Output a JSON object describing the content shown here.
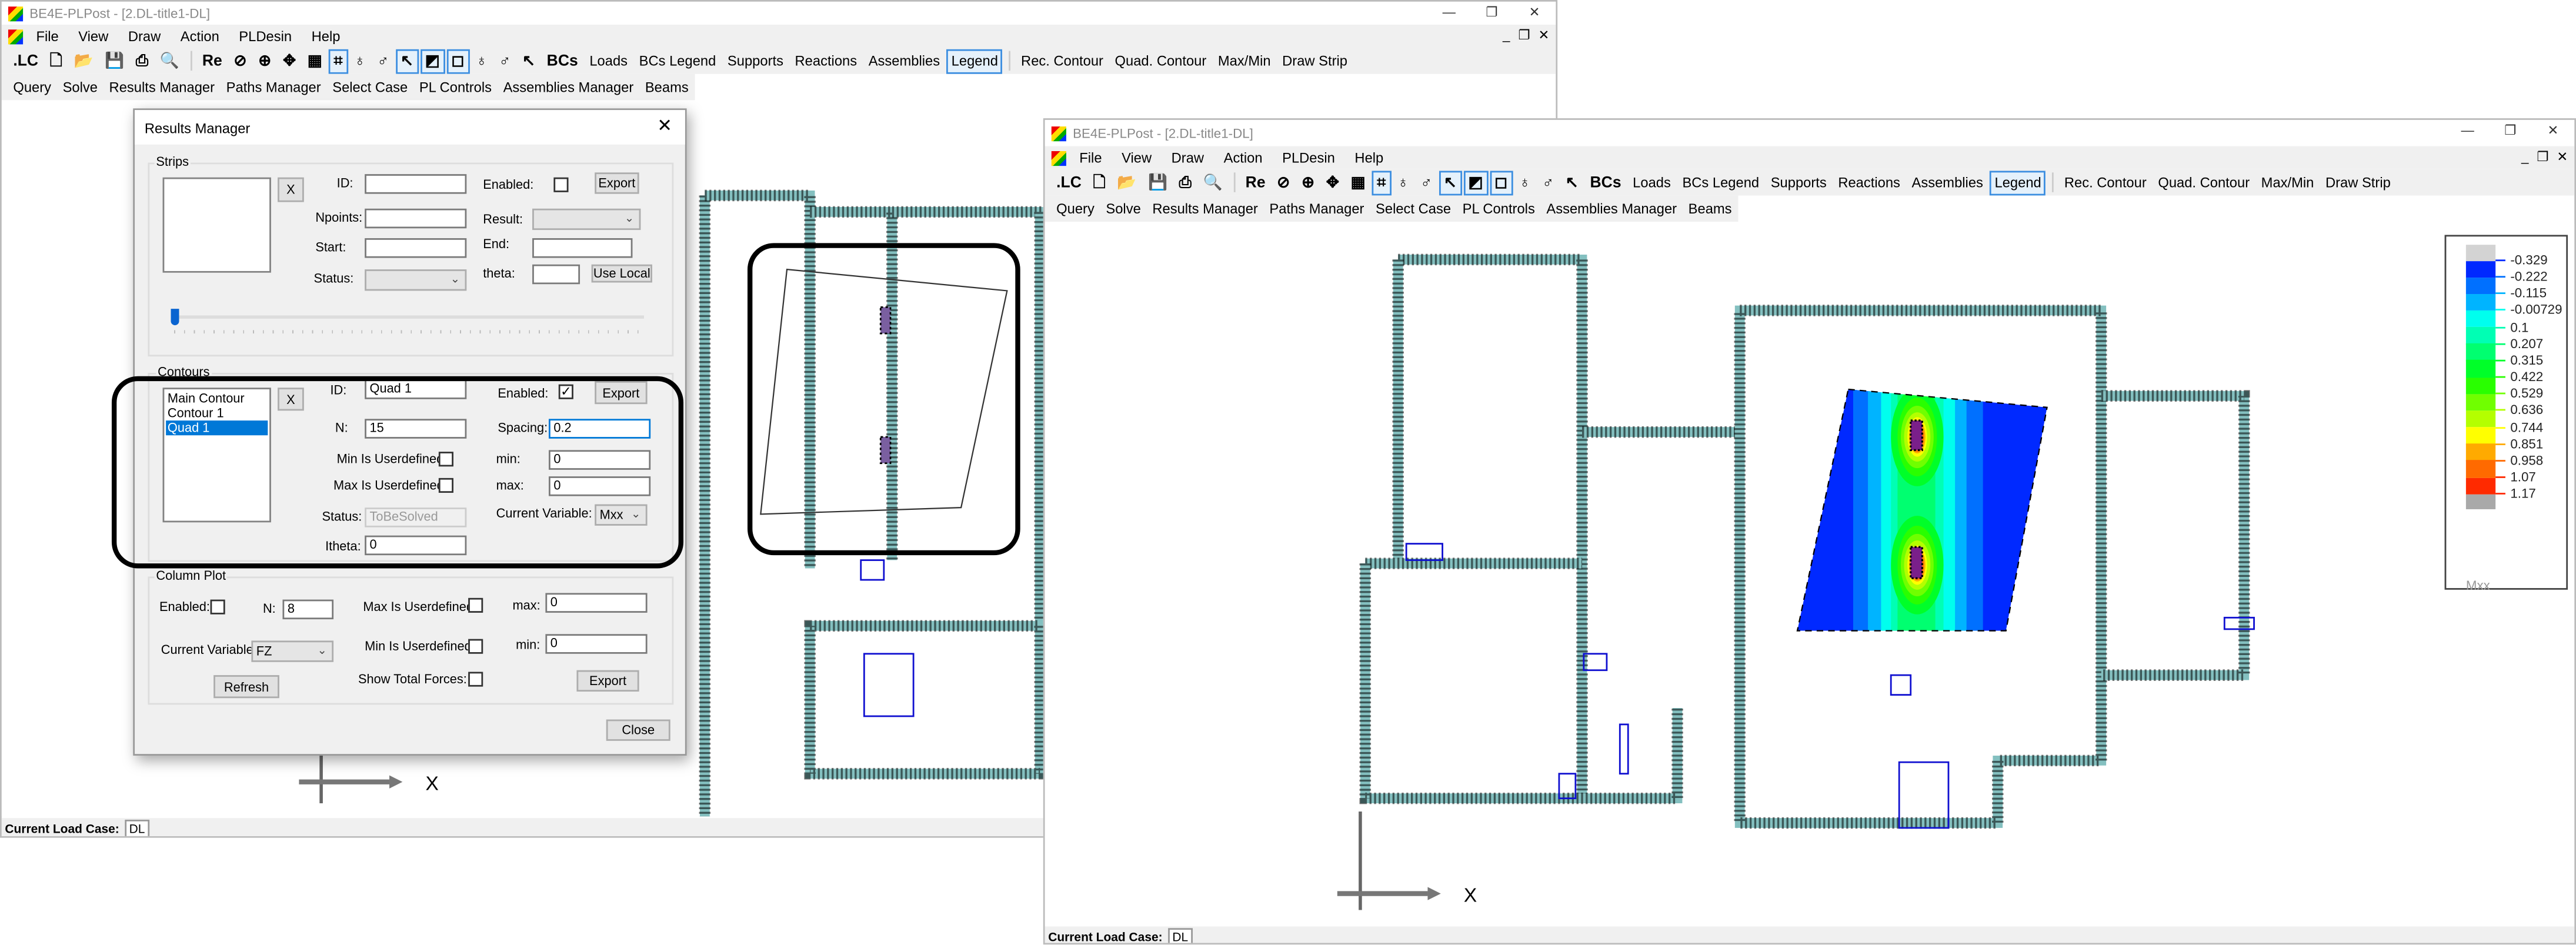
{
  "left_window": {
    "title": "BE4E-PLPost - [2.DL-title1-DL]",
    "menu": [
      "File",
      "View",
      "Draw",
      "Action",
      "PLDesin",
      "Help"
    ],
    "toolbar1": [
      {
        "label": ".LC",
        "icon": "load-case-icon",
        "glyph": ".LC"
      },
      {
        "label": "",
        "icon": "new-file-icon",
        "glyph": "🗋"
      },
      {
        "label": "",
        "icon": "open-folder-icon",
        "glyph": "📂"
      },
      {
        "label": "",
        "icon": "save-icon",
        "glyph": "💾"
      },
      {
        "label": "",
        "icon": "print-icon",
        "glyph": "⎙"
      },
      {
        "label": "",
        "icon": "print-preview-icon",
        "glyph": "🔍"
      },
      {
        "sep": true
      },
      {
        "label": "Re",
        "icon": "redraw-icon",
        "glyph": "Re"
      },
      {
        "label": "",
        "icon": "zoom-window-icon",
        "glyph": "⊘"
      },
      {
        "label": "",
        "icon": "zoom-in-icon",
        "glyph": "⊕"
      },
      {
        "label": "",
        "icon": "pan-icon",
        "glyph": "✥"
      },
      {
        "label": "",
        "icon": "grid-icon",
        "glyph": "▦"
      },
      {
        "label": "",
        "icon": "mesh-icon",
        "glyph": "⌗",
        "selected": true
      },
      {
        "label": "",
        "icon": "column-icon",
        "glyph": "♁"
      },
      {
        "label": "",
        "icon": "column-outline-icon",
        "glyph": "♂"
      },
      {
        "label": "",
        "icon": "wall-icon",
        "glyph": "↖",
        "selected": true
      },
      {
        "label": "",
        "icon": "slab-icon",
        "glyph": "◩",
        "selected": true
      },
      {
        "label": "",
        "icon": "slab-outline-icon",
        "glyph": "◻",
        "selected": true
      },
      {
        "label": "",
        "icon": "column-support-icon",
        "glyph": "♁"
      },
      {
        "label": "",
        "icon": "column-support-outline-icon",
        "glyph": "♂"
      },
      {
        "label": "",
        "icon": "wall-support-icon",
        "glyph": "↖"
      },
      {
        "label": "BCs",
        "icon": "bcs-icon",
        "glyph": "BCs"
      },
      {
        "label": "Loads"
      },
      {
        "label": "BCs Legend"
      },
      {
        "label": "Supports"
      },
      {
        "label": "Reactions"
      },
      {
        "label": "Assemblies"
      },
      {
        "label": "Legend",
        "selected": true
      },
      {
        "sep": true
      },
      {
        "label": "Rec. Contour"
      },
      {
        "label": "Quad. Contour"
      },
      {
        "label": "Max/Min"
      },
      {
        "label": "Draw Strip"
      }
    ],
    "toolbar2": [
      "Query",
      "Solve",
      "Results Manager",
      "Paths Manager",
      "Select Case",
      "PL Controls",
      "Assemblies Manager",
      "Beams"
    ],
    "axis_label": "X",
    "status": {
      "label": "Current Load Case:",
      "value": "DL"
    }
  },
  "right_window": {
    "title": "BE4E-PLPost - [2.DL-title1-DL]",
    "menu": [
      "File",
      "View",
      "Draw",
      "Action",
      "PLDesin",
      "Help"
    ],
    "toolbar2": [
      "Query",
      "Solve",
      "Results Manager",
      "Paths Manager",
      "Select Case",
      "PL Controls",
      "Assemblies Manager",
      "Beams"
    ],
    "axis_label": "X",
    "status": {
      "label": "Current Load Case:",
      "value": "DL"
    },
    "legend": {
      "variable": "Mxx",
      "labels": [
        "-0.329",
        "-0.222",
        "-0.115",
        "-0.00729",
        "0.1",
        "0.207",
        "0.315",
        "0.422",
        "0.529",
        "0.636",
        "0.744",
        "0.851",
        "0.958",
        "1.07",
        "1.17"
      ],
      "band_colors": [
        "#0029ff",
        "#0070ff",
        "#00b4ff",
        "#00ffee",
        "#00ffb4",
        "#00ff70",
        "#00ff29",
        "#29ff00",
        "#70ff00",
        "#b4ff00",
        "#ffff00",
        "#ffaa00",
        "#ff6a00",
        "#ff2a00"
      ],
      "above_color": "#d3d3d3",
      "below_color": "#a9a9a9"
    }
  },
  "results_manager": {
    "title": "Results Manager",
    "strips": {
      "group_label": "Strips",
      "delete_label": "X",
      "id_label": "ID:",
      "id_value": "",
      "enabled_label": "Enabled:",
      "enabled": false,
      "export_label": "Export",
      "npoints_label": "Npoints:",
      "npoints_value": "",
      "result_label": "Result:",
      "result_value": "",
      "start_label": "Start:",
      "start_value": "",
      "end_label": "End:",
      "end_value": "",
      "status_label": "Status:",
      "status_value": "",
      "theta_label": "theta:",
      "theta_value": "",
      "use_local_label": "Use Local",
      "slider_value": 0
    },
    "contours": {
      "group_label": "Contours",
      "items": [
        "Main Contour",
        "Contour 1",
        "Quad 1"
      ],
      "selected_index": 2,
      "delete_label": "X",
      "id_label": "ID:",
      "id_value": "Quad 1",
      "enabled_label": "Enabled:",
      "enabled": true,
      "export_label": "Export",
      "n_label": "N:",
      "n_value": "15",
      "spacing_label": "Spacing:",
      "spacing_value": "0.2",
      "min_user_label": "Min Is Userdefined:",
      "min_user": false,
      "min_label": "min:",
      "min_value": "0",
      "max_user_label": "Max Is Userdefined:",
      "max_user": false,
      "max_label": "max:",
      "max_value": "0",
      "status_label": "Status:",
      "status_value": "ToBeSolved",
      "current_variable_label": "Current Variable:",
      "current_variable": "Mxx",
      "itheta_label": "Itheta:",
      "itheta_value": "0"
    },
    "column_plot": {
      "group_label": "Column Plot",
      "enabled_label": "Enabled:",
      "enabled": false,
      "n_label": "N:",
      "n_value": "8",
      "max_user_label": "Max Is Userdefined:",
      "max_user": false,
      "max_label": "max:",
      "max_value": "0",
      "current_variable_label": "Current Variable:",
      "current_variable": "FZ",
      "min_user_label": "Min Is Userdefined:",
      "min_user": false,
      "min_label": "min:",
      "min_value": "0",
      "refresh_label": "Refresh",
      "show_total_label": "Show Total Forces:",
      "show_total": false,
      "export_label": "Export"
    },
    "close_label": "Close"
  }
}
